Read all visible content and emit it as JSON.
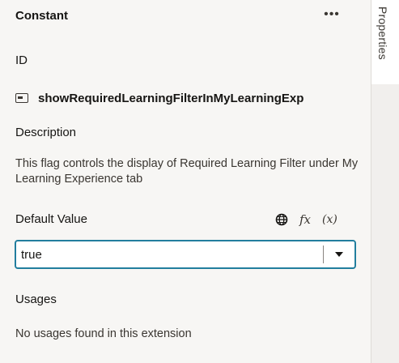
{
  "panel": {
    "title": "Constant",
    "more_label": "•••"
  },
  "rail": {
    "tab_label": "Properties"
  },
  "id_section": {
    "label": "ID",
    "value": "showRequiredLearningFilterInMyLearningExp",
    "icon": "constant-icon"
  },
  "description_section": {
    "label": "Description",
    "text": "This flag controls the display of Required Learning Filter under My Learning Experience tab"
  },
  "default_value_section": {
    "label": "Default Value",
    "icons": [
      "globe-icon",
      "fx-icon",
      "variable-icon"
    ],
    "fx_label": "fx",
    "variable_label": "(x)",
    "input_value": "true"
  },
  "usages_section": {
    "label": "Usages",
    "text": "No usages found in this extension"
  },
  "colors": {
    "panel_bg": "#f7f6f4",
    "focus_border": "#227e9e",
    "text": "#161513"
  }
}
